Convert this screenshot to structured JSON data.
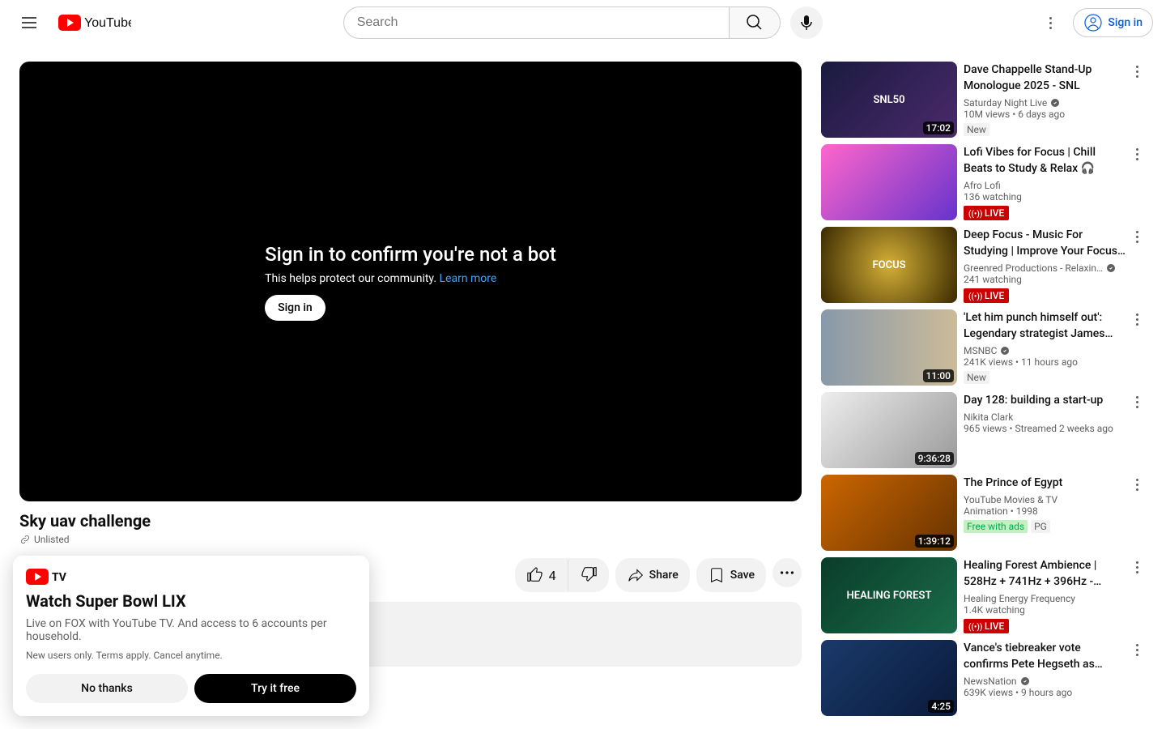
{
  "header": {
    "search_placeholder": "Search",
    "signin_label": "Sign in"
  },
  "player": {
    "heading": "Sign in to confirm you're not a bot",
    "subtext": "This helps protect our community. ",
    "learn_more": "Learn more",
    "signin_label": "Sign in"
  },
  "video": {
    "title": "Sky uav challenge",
    "unlisted_label": "Unlisted",
    "like_count": "4",
    "share_label": "Share",
    "save_label": "Save"
  },
  "promo": {
    "title": "Watch Super Bowl LIX",
    "body": "Live on FOX with YouTube TV. And access to 6 accounts per household.",
    "fine": "New users only. Terms apply. Cancel anytime.",
    "no_label": "No thanks",
    "try_label": "Try it free"
  },
  "recs": [
    {
      "title": "Dave Chappelle Stand-Up Monologue 2025 - SNL",
      "channel": "Saturday Night Live",
      "verified": true,
      "stats": "10M views  • 6 days ago",
      "duration": "17:02",
      "badge": "New",
      "thumb_bg": "linear-gradient(135deg,#1a1a40,#4b2a6b)",
      "thumb_label": "SNL50"
    },
    {
      "title": "Lofi Vibes for Focus | Chill Beats to Study & Relax 🎧",
      "channel": "Afro Lofi",
      "verified": false,
      "stats": "136 watching",
      "duration": "",
      "badge": "LIVE",
      "thumb_bg": "linear-gradient(135deg,#ff66cc,#6633cc)",
      "thumb_label": ""
    },
    {
      "title": "Deep Focus - Music For Studying | Improve Your Focus…",
      "channel": "Greenred Productions - Relaxin…",
      "verified": true,
      "stats": "241 watching",
      "duration": "",
      "badge": "LIVE",
      "thumb_bg": "radial-gradient(circle,#d4af37,#3a2a00)",
      "thumb_label": "FOCUS"
    },
    {
      "title": "'Let him punch himself out': Legendary strategist James…",
      "channel": "MSNBC",
      "verified": true,
      "stats": "241K views  • 11 hours ago",
      "duration": "11:00",
      "badge": "New",
      "thumb_bg": "linear-gradient(90deg,#8899aa,#ccbb99)",
      "thumb_label": ""
    },
    {
      "title": "Day 128: building a start-up",
      "channel": "Nikita Clark",
      "verified": false,
      "stats": "965 views  • Streamed 2 weeks ago",
      "duration": "9:36:28",
      "badge": "",
      "thumb_bg": "linear-gradient(135deg,#eeeeee,#999999)",
      "thumb_label": ""
    },
    {
      "title": "The Prince of Egypt",
      "channel": "YouTube Movies & TV",
      "verified": false,
      "stats": "Animation • 1998",
      "duration": "1:39:12",
      "badge": "Free with ads",
      "badge2": "PG",
      "thumb_bg": "linear-gradient(135deg,#cc6600,#663300)",
      "thumb_label": ""
    },
    {
      "title": "Healing Forest Ambience | 528Hz + 741Hz + 396Hz -…",
      "channel": "Healing Energy Frequency",
      "verified": false,
      "stats": "1.4K watching",
      "duration": "",
      "badge": "LIVE",
      "thumb_bg": "linear-gradient(135deg,#0a3d2a,#1a6b4a)",
      "thumb_label": "HEALING FOREST"
    },
    {
      "title": "Vance's tiebreaker vote confirms Pete Hegseth as…",
      "channel": "NewsNation",
      "verified": true,
      "stats": "639K views  • 9 hours ago",
      "duration": "4:25",
      "badge": "",
      "thumb_bg": "linear-gradient(135deg,#1a3a6b,#0a1a3a)",
      "thumb_label": ""
    }
  ]
}
